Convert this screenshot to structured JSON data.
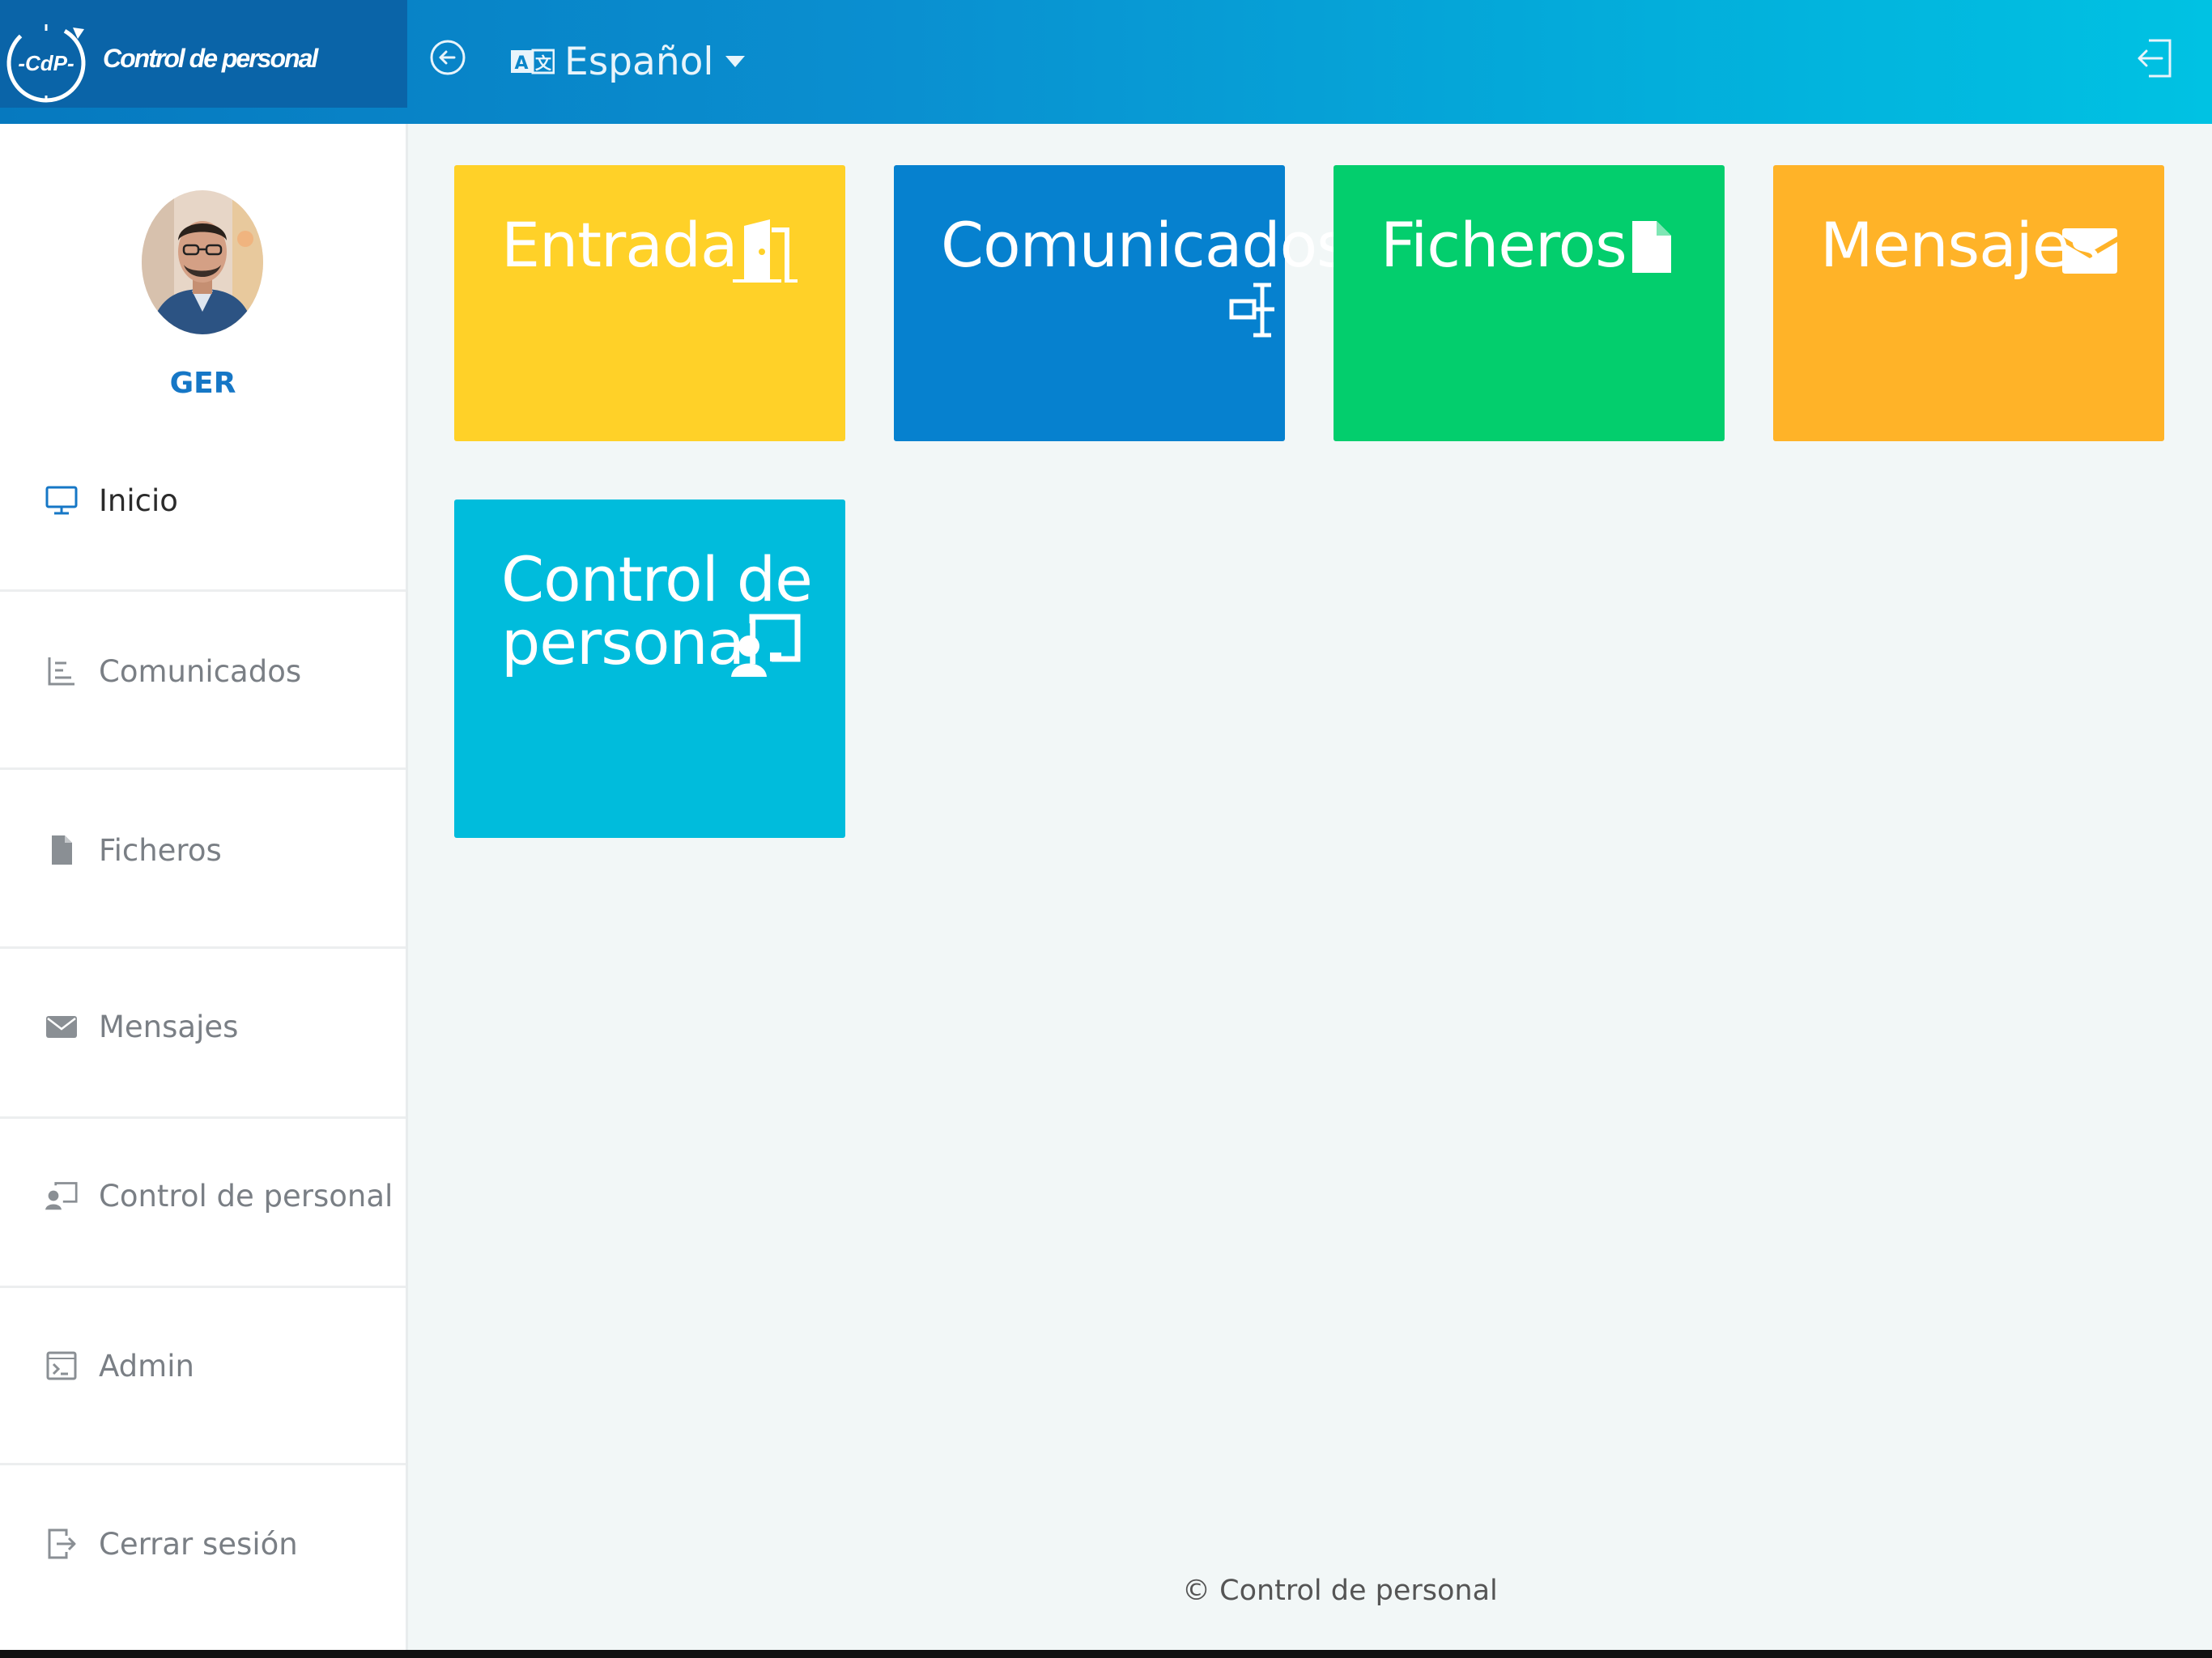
{
  "header": {
    "brand_logo_text": "-CdP-",
    "brand_name": "Control de personal",
    "language": "Español",
    "colors": {
      "brand_bg": "#0a64a8",
      "bar_start": "#0679bf",
      "bar_end": "#00c2e3"
    }
  },
  "user": {
    "name": "GER"
  },
  "sidebar": {
    "items": [
      {
        "label": "Inicio",
        "icon": "monitor-icon",
        "active": true
      },
      {
        "label": "Comunicados",
        "icon": "tree-list-icon",
        "active": false
      },
      {
        "label": "Ficheros",
        "icon": "file-icon",
        "active": false
      },
      {
        "label": "Mensajes",
        "icon": "envelope-icon",
        "active": false
      },
      {
        "label": "Control de personal",
        "icon": "person-board-icon",
        "active": false
      },
      {
        "label": "Admin",
        "icon": "terminal-icon",
        "active": false
      },
      {
        "label": "Cerrar sesión",
        "icon": "sign-out-icon",
        "active": false
      }
    ]
  },
  "tiles": [
    {
      "label": "Entrada",
      "icon": "door-icon",
      "color": "#ffd128"
    },
    {
      "label": "Comunicados",
      "icon": "sitemap-icon",
      "color": "#0681cf"
    },
    {
      "label": "Ficheros",
      "icon": "file-icon",
      "color": "#03ce6d"
    },
    {
      "label": "Mensajes",
      "icon": "envelope-icon",
      "color": "#ffb328"
    },
    {
      "label_line1": "Control de",
      "label_line2": "personal",
      "icon": "person-board-icon",
      "color": "#00bcdc"
    }
  ],
  "footer": {
    "text": "© Control de personal"
  }
}
